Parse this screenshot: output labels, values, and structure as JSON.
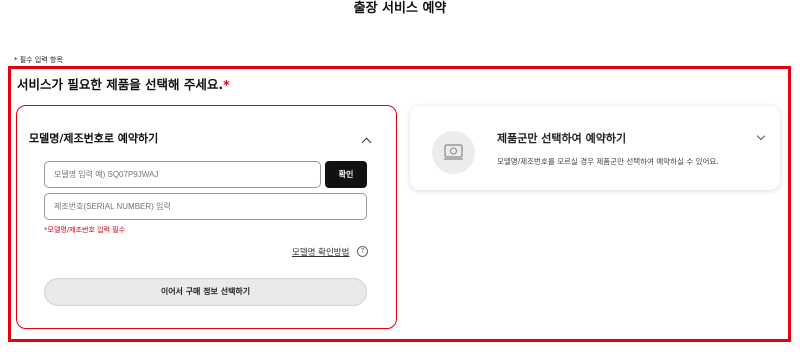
{
  "header": {
    "title": "출장 서비스 예약"
  },
  "form": {
    "required_note": "* 필수 입력 항목",
    "section_title": "서비스가 필요한 제품을 선택해 주세요.",
    "section_required_mark": "*"
  },
  "model_card": {
    "title": "모델명/제조번호로 예약하기",
    "model_input": {
      "value": "",
      "placeholder": "모델명 입력 예) SQ07P9JWAJ"
    },
    "confirm_button": "확인",
    "serial_input": {
      "value": "",
      "placeholder": "제조번호(SERIAL NUMBER) 입력"
    },
    "required_message": "*모델명/제조번호 입력 필수",
    "how_to_check_link": "모델명 확인방법",
    "help_icon": "?",
    "next_button": "이어서 구매 정보 선택하기"
  },
  "category_card": {
    "title": "제품군만 선택하여 예약하기",
    "description": "모델명/제조번호를 모르실 경우 제품군만 선택하여 예약하실 수 있어요."
  },
  "icons": {
    "model_card_toggle": "chevron-up-icon",
    "category_card_toggle": "chevron-down-icon",
    "category_card_icon": "laptop-icon"
  },
  "colors": {
    "accent_red": "#e2000f",
    "button_dark": "#111111",
    "button_disabled": "#eaeaea"
  }
}
